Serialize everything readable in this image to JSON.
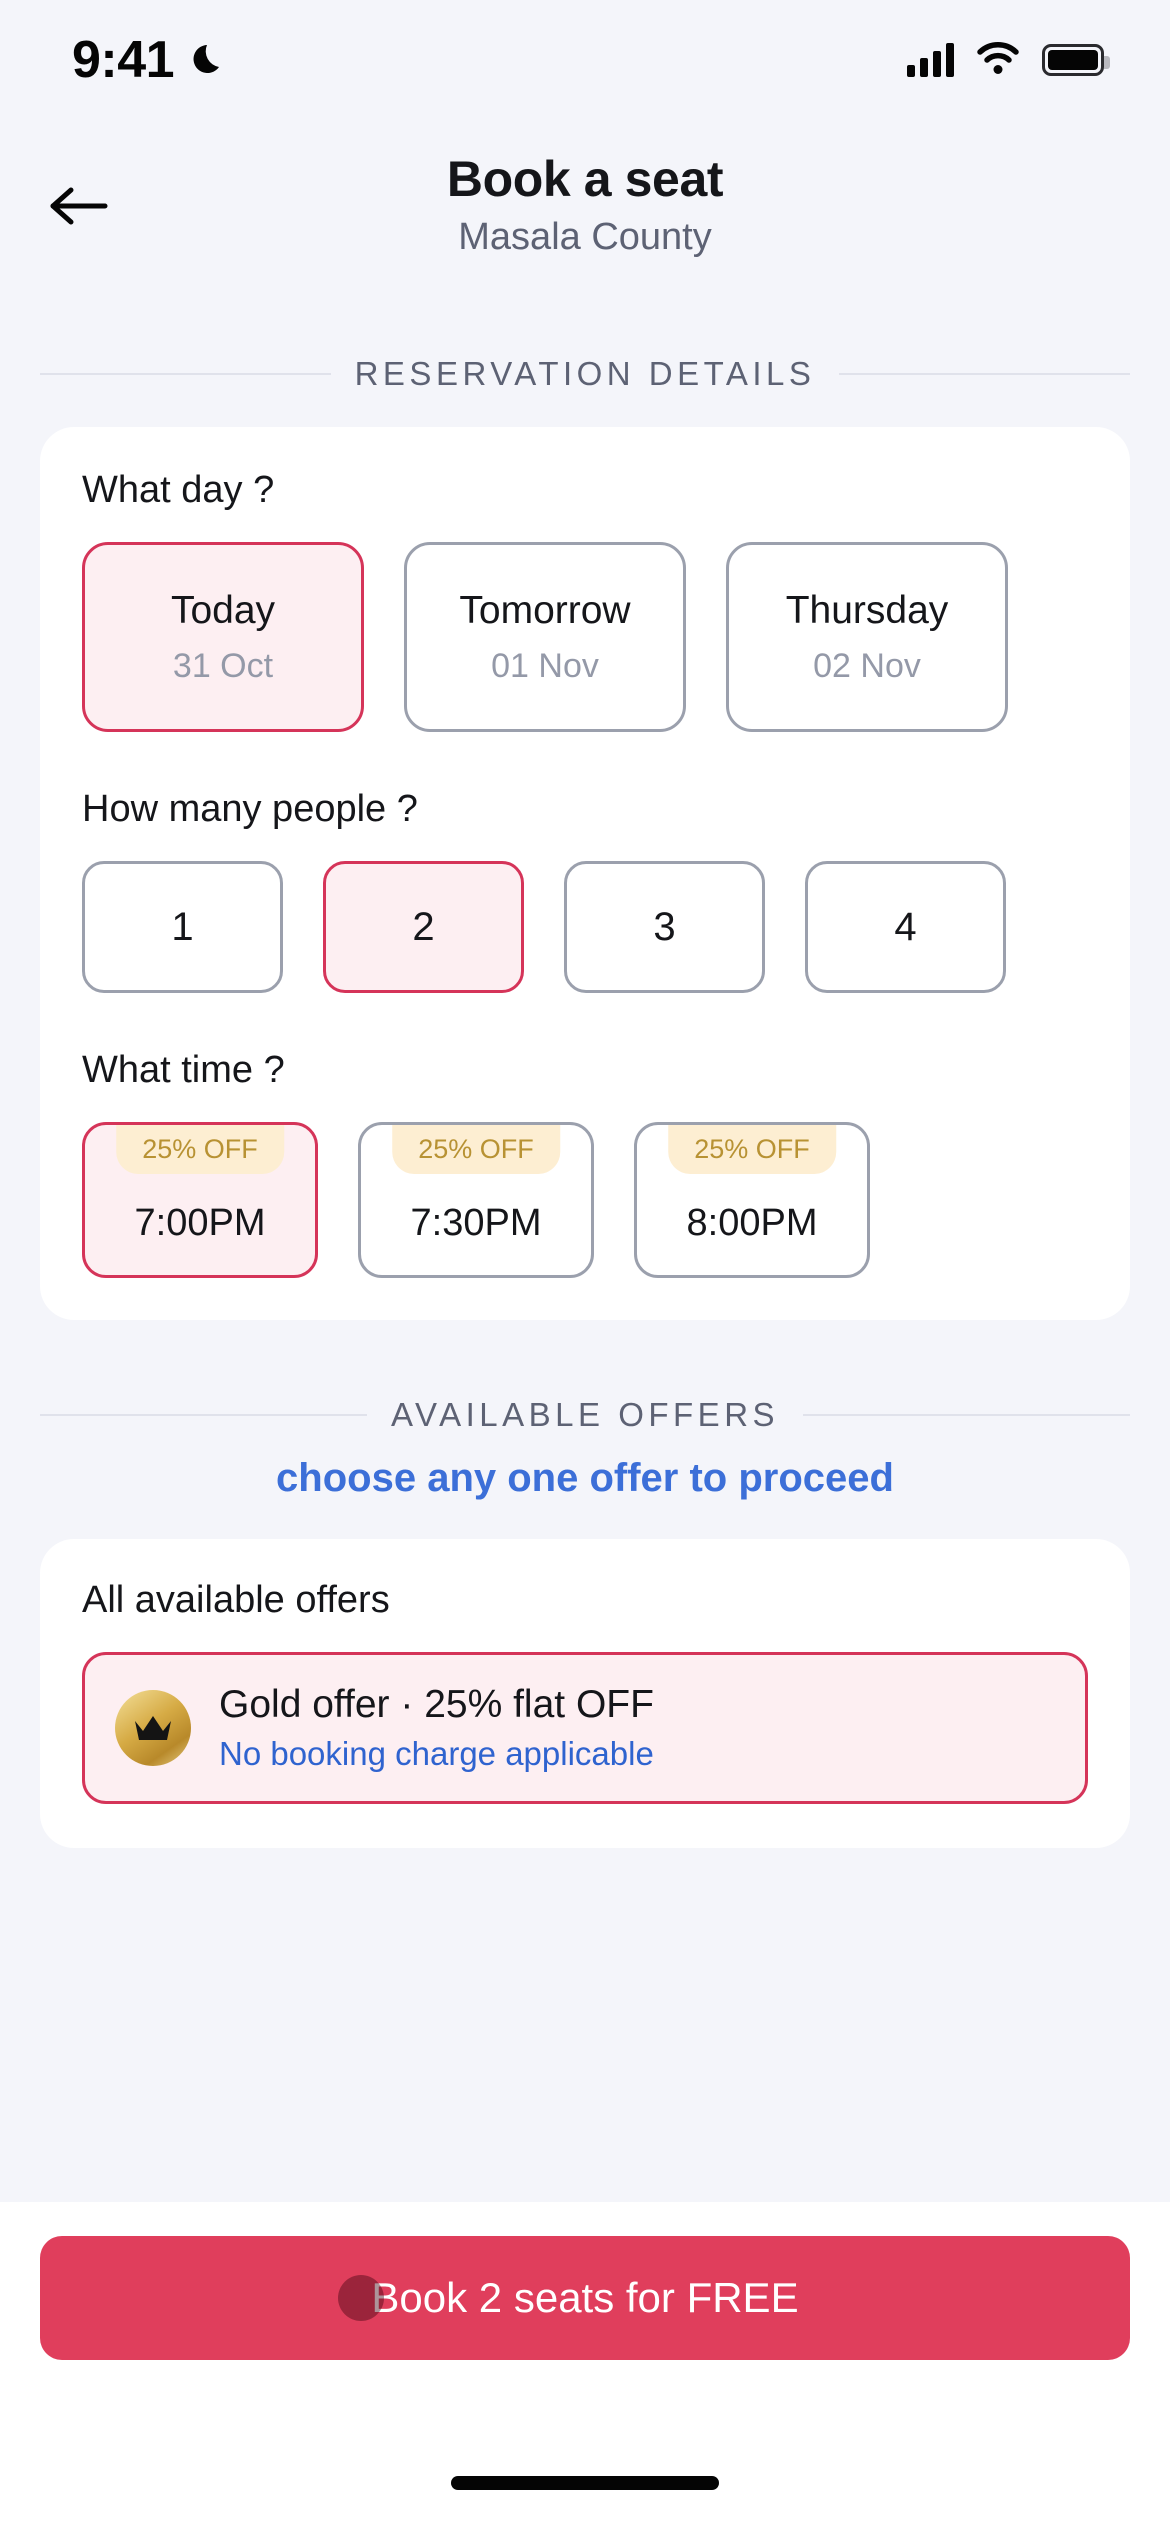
{
  "status_bar": {
    "time": "9:41",
    "dnd_icon": "crescent-moon-icon",
    "signal_icon": "cellular-signal-icon",
    "wifi_icon": "wifi-icon",
    "battery_icon": "battery-full-icon"
  },
  "header": {
    "back_icon": "arrow-left-icon",
    "title": "Book a seat",
    "subtitle": "Masala County"
  },
  "reservation": {
    "section_label": "RESERVATION DETAILS",
    "day_question": "What day ?",
    "days": [
      {
        "name": "Today",
        "date": "31 Oct",
        "selected": true
      },
      {
        "name": "Tomorrow",
        "date": "01 Nov",
        "selected": false
      },
      {
        "name": "Thursday",
        "date": "02 Nov",
        "selected": false
      }
    ],
    "people_question": "How many people ?",
    "people": [
      {
        "count": "1",
        "selected": false
      },
      {
        "count": "2",
        "selected": true
      },
      {
        "count": "3",
        "selected": false
      },
      {
        "count": "4",
        "selected": false
      }
    ],
    "time_question": "What time ?",
    "times": [
      {
        "badge": "25% OFF",
        "time": "7:00PM",
        "selected": true
      },
      {
        "badge": "25% OFF",
        "time": "7:30PM",
        "selected": false
      },
      {
        "badge": "25% OFF",
        "time": "8:00PM",
        "selected": false
      }
    ]
  },
  "offers": {
    "section_label": "AVAILABLE OFFERS",
    "instruction": "choose any one offer to proceed",
    "list_title": "All available offers",
    "items": [
      {
        "icon": "crown-icon",
        "title": "Gold offer · 25% flat OFF",
        "note": "No booking charge applicable",
        "selected": true
      }
    ]
  },
  "cta": {
    "label": "Book 2 seats for FREE"
  },
  "colors": {
    "accent": "#d53459",
    "cta": "#e03e5c",
    "accent_fill": "#fdeff2",
    "link_blue": "#3c6fd8",
    "gold": "#b89233",
    "badge_bg": "#fdeed2",
    "page_bg": "#f4f5fa"
  }
}
